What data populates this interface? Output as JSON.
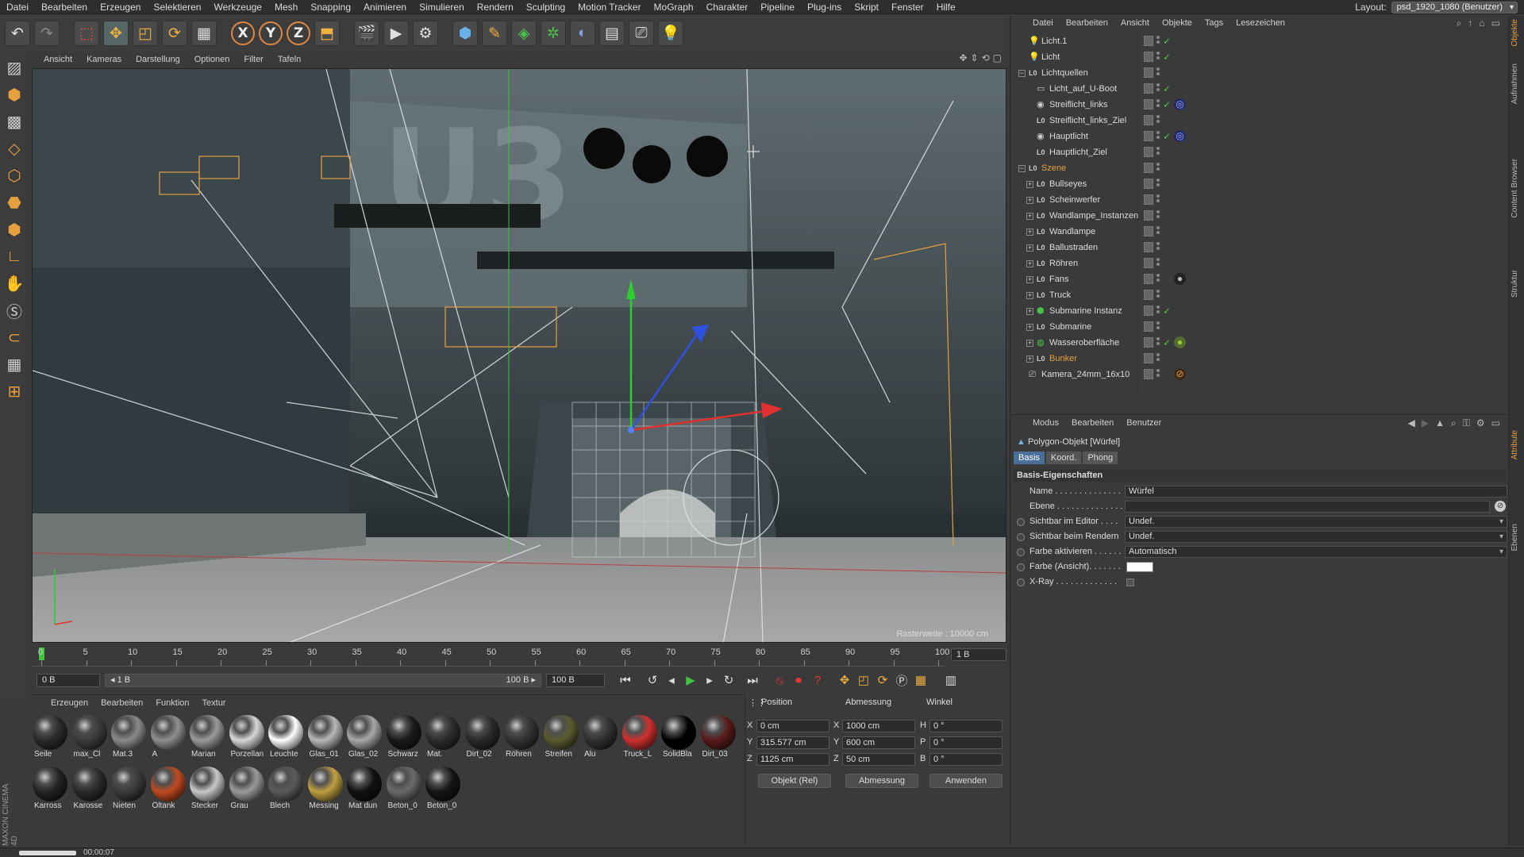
{
  "menu": [
    "Datei",
    "Bearbeiten",
    "Erzeugen",
    "Selektieren",
    "Werkzeuge",
    "Mesh",
    "Snapping",
    "Animieren",
    "Simulieren",
    "Rendern",
    "Sculpting",
    "Motion Tracker",
    "MoGraph",
    "Charakter",
    "Pipeline",
    "Plug-ins",
    "Skript",
    "Fenster",
    "Hilfe"
  ],
  "layout": {
    "label": "Layout:",
    "value": "psd_1920_1080 (Benutzer)"
  },
  "toolbar": {
    "tools": [
      "undo-icon",
      "redo-icon",
      "select-icon",
      "move-icon",
      "scale-icon",
      "rotate-icon",
      "model-icon"
    ],
    "axes": [
      "X",
      "Y",
      "Z"
    ],
    "render_tools": [
      "coord-system-icon",
      "render-view-icon",
      "render-picture-icon",
      "render-settings-icon",
      "cube-icon",
      "pen-icon",
      "subdivision-icon",
      "cloner-icon",
      "deformer-icon",
      "floor-icon",
      "camera-icon",
      "light-icon"
    ]
  },
  "viewport": {
    "menu": [
      "Ansicht",
      "Kameras",
      "Darstellung",
      "Optionen",
      "Filter",
      "Tafeln"
    ],
    "raster": "Rasterweite : 10000 cm"
  },
  "timeline": {
    "ticks": [
      "0",
      "5",
      "10",
      "15",
      "20",
      "25",
      "30",
      "35",
      "40",
      "45",
      "50",
      "55",
      "60",
      "65",
      "70",
      "75",
      "80",
      "85",
      "90",
      "95",
      "100"
    ],
    "current_frame": 0,
    "end_field": "1 B"
  },
  "transport": {
    "start": "0 B",
    "range_start": "◂ 1 B",
    "range_end": "100 B ▸",
    "end": "100 B"
  },
  "materials": {
    "menu": [
      "Erzeugen",
      "Bearbeiten",
      "Funktion",
      "Textur"
    ],
    "row1": [
      {
        "name": "Seile",
        "color": "#2a2a2a"
      },
      {
        "name": "max_Cl",
        "color": "#3b3b3b"
      },
      {
        "name": "Mat.3",
        "color": "#8a8a8a"
      },
      {
        "name": "A",
        "color": "#8f8f8f"
      },
      {
        "name": "Marian",
        "color": "#9a9a9a"
      },
      {
        "name": "Porzellan",
        "color": "#d8d8d8"
      },
      {
        "name": "Leuchte",
        "color": "#ffffff"
      },
      {
        "name": "Glas_01",
        "color": "#b8b8b8"
      },
      {
        "name": "Glas_02",
        "color": "#a8a8a8"
      },
      {
        "name": "Schwarz",
        "color": "#1a1a1a"
      },
      {
        "name": "Mat.",
        "color": "#2c2c2c"
      },
      {
        "name": "Dirt_02",
        "color": "#2a2a2a"
      },
      {
        "name": "Röhren",
        "color": "#333333"
      },
      {
        "name": "Streifen",
        "color": "#5a5a30"
      },
      {
        "name": "Alu",
        "color": "#303030"
      },
      {
        "name": "Truck_L",
        "color": "#d03030"
      },
      {
        "name": "SolidBla",
        "color": "#000000"
      },
      {
        "name": "Dirt_03",
        "color": "#5a1a1a"
      }
    ],
    "row2": [
      {
        "name": "Karross",
        "color": "#222222"
      },
      {
        "name": "Karosse",
        "color": "#2a2a2a"
      },
      {
        "name": "Nieten",
        "color": "#3a3a3a"
      },
      {
        "name": "Öltank",
        "color": "#c04a20"
      },
      {
        "name": "Stecker",
        "color": "#c8c8c8"
      },
      {
        "name": "Grau",
        "color": "#9a9a9a"
      },
      {
        "name": "Blech",
        "color": "#5a5a5a"
      },
      {
        "name": "Messing",
        "color": "#c0a040"
      },
      {
        "name": "Mat dun",
        "color": "#111111"
      },
      {
        "name": "Beton_0",
        "color": "#6a6a6a"
      },
      {
        "name": "Beton_0",
        "color": "#151515"
      }
    ]
  },
  "coords": {
    "headers": [
      "Position",
      "Abmessung",
      "Winkel"
    ],
    "rows": [
      {
        "axis": "X",
        "pos": "0 cm",
        "dimaxis": "X",
        "dim": "1000 cm",
        "angaxis": "H",
        "ang": "0 °"
      },
      {
        "axis": "Y",
        "pos": "315.577 cm",
        "dimaxis": "Y",
        "dim": "600 cm",
        "angaxis": "P",
        "ang": "0 °"
      },
      {
        "axis": "Z",
        "pos": "1125 cm",
        "dimaxis": "Z",
        "dim": "50 cm",
        "angaxis": "B",
        "ang": "0 °"
      }
    ],
    "mode1": "Objekt (Rel)",
    "mode2": "Abmessung",
    "apply": "Anwenden"
  },
  "status": {
    "time": "00:00:07",
    "progress": 0.95
  },
  "objects": {
    "menu": [
      "Datei",
      "Bearbeiten",
      "Ansicht",
      "Objekte",
      "Tags",
      "Lesezeichen"
    ],
    "rows": [
      {
        "name": "Licht.1",
        "indent": 0,
        "expander": "",
        "icon": "light-icon",
        "color": "#dcdcdc",
        "check": "✓",
        "tag": ""
      },
      {
        "name": "Licht",
        "indent": 0,
        "expander": "",
        "icon": "light-icon",
        "color": "#dcdcdc",
        "check": "✓",
        "tag": ""
      },
      {
        "name": "Lichtquellen",
        "indent": 0,
        "expander": "−",
        "icon": "null-icon",
        "color": "#dcdcdc",
        "check": "",
        "tag": ""
      },
      {
        "name": "Licht_auf_U-Boot",
        "indent": 1,
        "expander": "",
        "icon": "area-light-icon",
        "color": "#dcdcdc",
        "check": "✓",
        "tag": ""
      },
      {
        "name": "Streiflicht_links",
        "indent": 1,
        "expander": "",
        "icon": "spot-icon",
        "color": "#dcdcdc",
        "check": "✓",
        "tag": "target"
      },
      {
        "name": "Streiflicht_links_Ziel",
        "indent": 1,
        "expander": "",
        "icon": "null-icon",
        "color": "#dcdcdc",
        "check": "",
        "tag": ""
      },
      {
        "name": "Hauptlicht",
        "indent": 1,
        "expander": "",
        "icon": "spot-icon",
        "color": "#dcdcdc",
        "check": "✓",
        "tag": "target"
      },
      {
        "name": "Hauptlicht_Ziel",
        "indent": 1,
        "expander": "",
        "icon": "null-icon",
        "color": "#dcdcdc",
        "check": "",
        "tag": ""
      },
      {
        "name": "Szene",
        "indent": 0,
        "expander": "−",
        "icon": "null-icon",
        "color": "#e6a040",
        "check": "",
        "tag": ""
      },
      {
        "name": "Bullseyes",
        "indent": 1,
        "expander": "+",
        "icon": "null-icon",
        "color": "#dcdcdc",
        "check": "",
        "tag": ""
      },
      {
        "name": "Scheinwerfer",
        "indent": 1,
        "expander": "+",
        "icon": "null-icon",
        "color": "#dcdcdc",
        "check": "",
        "tag": ""
      },
      {
        "name": "Wandlampe_Instanzen",
        "indent": 1,
        "expander": "+",
        "icon": "null-icon",
        "color": "#dcdcdc",
        "check": "",
        "tag": ""
      },
      {
        "name": "Wandlampe",
        "indent": 1,
        "expander": "+",
        "icon": "null-icon",
        "color": "#dcdcdc",
        "check": "",
        "tag": ""
      },
      {
        "name": "Ballustraden",
        "indent": 1,
        "expander": "+",
        "icon": "null-icon",
        "color": "#dcdcdc",
        "check": "",
        "tag": ""
      },
      {
        "name": "Röhren",
        "indent": 1,
        "expander": "+",
        "icon": "null-icon",
        "color": "#dcdcdc",
        "check": "",
        "tag": ""
      },
      {
        "name": "Fans",
        "indent": 1,
        "expander": "+",
        "icon": "null-icon",
        "color": "#dcdcdc",
        "check": "",
        "tag": "material"
      },
      {
        "name": "Truck",
        "indent": 1,
        "expander": "+",
        "icon": "null-icon",
        "color": "#dcdcdc",
        "check": "",
        "tag": ""
      },
      {
        "name": "Submarine Instanz",
        "indent": 1,
        "expander": "+",
        "icon": "instance-icon",
        "color": "#dcdcdc",
        "check": "✓",
        "tag": ""
      },
      {
        "name": "Submarine",
        "indent": 1,
        "expander": "+",
        "icon": "null-icon",
        "color": "#dcdcdc",
        "check": "",
        "tag": ""
      },
      {
        "name": "Wasseroberfläche",
        "indent": 1,
        "expander": "+",
        "icon": "plane-icon",
        "color": "#dcdcdc",
        "check": "✓",
        "tag": "material2"
      },
      {
        "name": "Bunker",
        "indent": 1,
        "expander": "+",
        "icon": "null-icon",
        "color": "#e6a040",
        "check": "",
        "tag": ""
      },
      {
        "name": "Kamera_24mm_16x10",
        "indent": 0,
        "expander": "",
        "icon": "camera-icon",
        "color": "#dcdcdc",
        "check": "",
        "tag": "protect"
      }
    ]
  },
  "attributes": {
    "menu": [
      "Modus",
      "Bearbeiten",
      "Benutzer"
    ],
    "title": "Polygon-Objekt [Würfel]",
    "tabs": [
      "Basis",
      "Koord.",
      "Phong"
    ],
    "section": "Basis-Eigenschaften",
    "fields": [
      {
        "label": "Name . . . . . . . . . . . . . .",
        "value": "Würfel",
        "type": "text",
        "radio": false
      },
      {
        "label": "Ebene . . . . . . . . . . . . . .",
        "value": "",
        "type": "text",
        "radio": false
      },
      {
        "label": "Sichtbar im Editor . . . .",
        "value": "Undef.",
        "type": "dd",
        "radio": true
      },
      {
        "label": "Sichtbar beim Rendern",
        "value": "Undef.",
        "type": "dd",
        "radio": true
      },
      {
        "label": "Farbe aktivieren . . . . . .",
        "value": "Automatisch",
        "type": "dd",
        "radio": true
      },
      {
        "label": "Farbe (Ansicht). . . . . . .",
        "value": "",
        "type": "color",
        "radio": true
      },
      {
        "label": "X-Ray . . . . . . . . . . . . .",
        "value": "",
        "type": "check",
        "radio": true
      }
    ]
  },
  "sidetabs": [
    "Objekte",
    "Aufnahmen",
    "Content Browser",
    "Struktur",
    "Attribute",
    "Ebenen"
  ],
  "logo": "MAXON CINEMA 4D"
}
